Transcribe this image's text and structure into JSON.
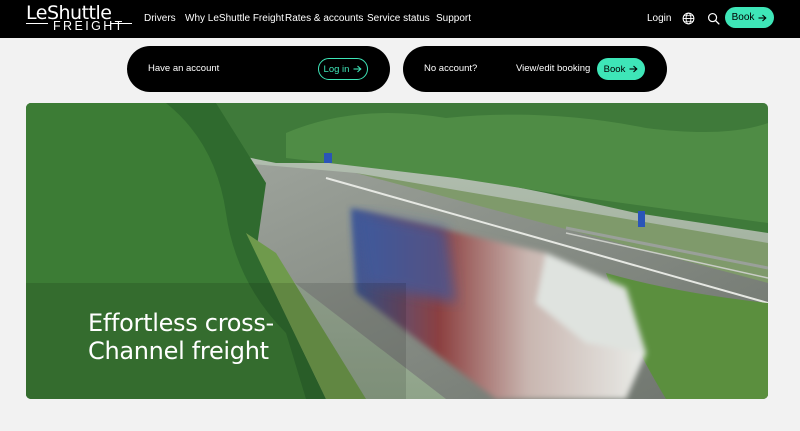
{
  "header": {
    "logo": {
      "top": "LeShuttle",
      "bottom": "FREIGHT"
    },
    "nav": [
      {
        "label": "Drivers"
      },
      {
        "label": "Why LeShuttle Freight"
      },
      {
        "label": "Rates & accounts"
      },
      {
        "label": "Service status"
      },
      {
        "label": "Support"
      }
    ],
    "login_label": "Login",
    "globe_icon": "globe-icon",
    "search_icon": "search-icon",
    "book_label": "Book",
    "arrow_icon": "arrow-right-icon"
  },
  "account_bar": {
    "have_account": {
      "text": "Have an account",
      "button_label": "Log in"
    },
    "no_account": {
      "text": "No account?",
      "link_label": "View/edit booking",
      "button_label": "Book"
    }
  },
  "hero": {
    "title_line1": "Effortless cross-",
    "title_line2": "Channel freight"
  },
  "colors": {
    "header_bg": "#000000",
    "accent": "#3ee6b8",
    "page_bg": "#f2f2f2"
  }
}
